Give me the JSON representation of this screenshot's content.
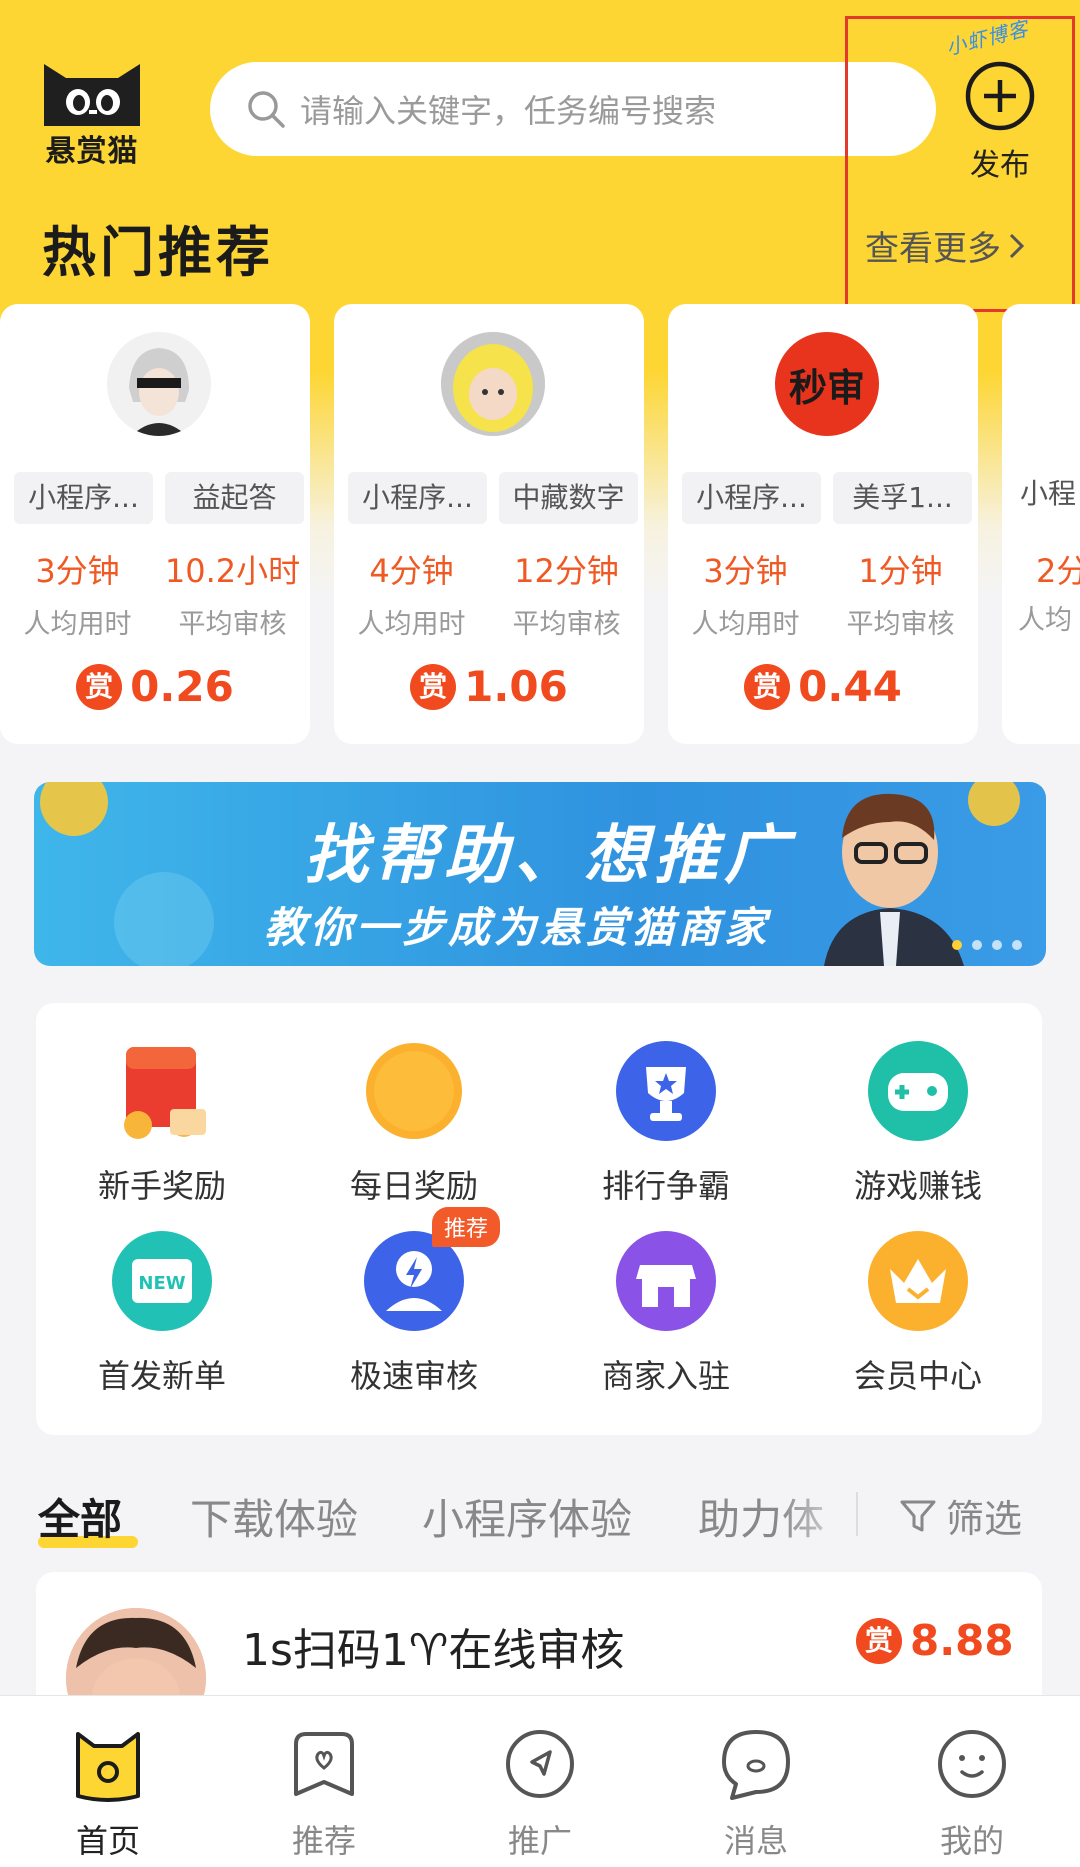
{
  "header": {
    "logo_text": "悬赏猫",
    "search_placeholder": "请输入关键字，任务编号搜索",
    "publish_label": "发布",
    "watermark": "小虾博客"
  },
  "hot": {
    "title": "热门推荐",
    "more_label": "查看更多",
    "cards": [
      {
        "tags": [
          "小程序...",
          "益起答"
        ],
        "time_value": "3分钟",
        "time_label": "人均用时",
        "review_value": "10.2小时",
        "review_label": "平均审核",
        "reward": "0.26"
      },
      {
        "tags": [
          "小程序...",
          "中藏数字"
        ],
        "time_value": "4分钟",
        "time_label": "人均用时",
        "review_value": "12分钟",
        "review_label": "平均审核",
        "reward": "1.06"
      },
      {
        "tags": [
          "小程序...",
          "美孚1..."
        ],
        "time_value": "3分钟",
        "time_label": "人均用时",
        "review_value": "1分钟",
        "review_label": "平均审核",
        "reward": "0.44",
        "avatar_text": "秒审"
      },
      {
        "tags": [
          "小程"
        ],
        "time_value": "2分",
        "time_label": "人均"
      }
    ],
    "reward_badge": "赏"
  },
  "banner": {
    "line1": "找帮助、想推广",
    "line2": "教你一步成为悬赏猫商家"
  },
  "features": [
    {
      "label": "新手奖励",
      "icon": "red-envelope-icon"
    },
    {
      "label": "每日奖励",
      "icon": "coin-icon"
    },
    {
      "label": "排行争霸",
      "icon": "trophy-icon"
    },
    {
      "label": "游戏赚钱",
      "icon": "gamepad-icon"
    },
    {
      "label": "首发新单",
      "icon": "new-ticket-icon",
      "icon_text": "NEW"
    },
    {
      "label": "极速审核",
      "icon": "lightning-user-icon",
      "badge": "推荐"
    },
    {
      "label": "商家入驻",
      "icon": "store-icon"
    },
    {
      "label": "会员中心",
      "icon": "crown-icon"
    }
  ],
  "tabs": {
    "items": [
      "全部",
      "下载体验",
      "小程序体验",
      "助力体"
    ],
    "active_index": 0,
    "filter_label": "筛选"
  },
  "task": {
    "title": "1s扫码1♈在线审核",
    "reward": "8.88"
  },
  "bottom_nav": [
    {
      "label": "首页",
      "icon": "home-cat-icon",
      "active": true
    },
    {
      "label": "推荐",
      "icon": "recommend-icon"
    },
    {
      "label": "推广",
      "icon": "promote-icon"
    },
    {
      "label": "消息",
      "icon": "message-icon"
    },
    {
      "label": "我的",
      "icon": "profile-icon"
    }
  ],
  "colors": {
    "brand_yellow": "#fdd634",
    "accent_orange": "#f04a1e",
    "highlight_box": "#e33a2d"
  }
}
